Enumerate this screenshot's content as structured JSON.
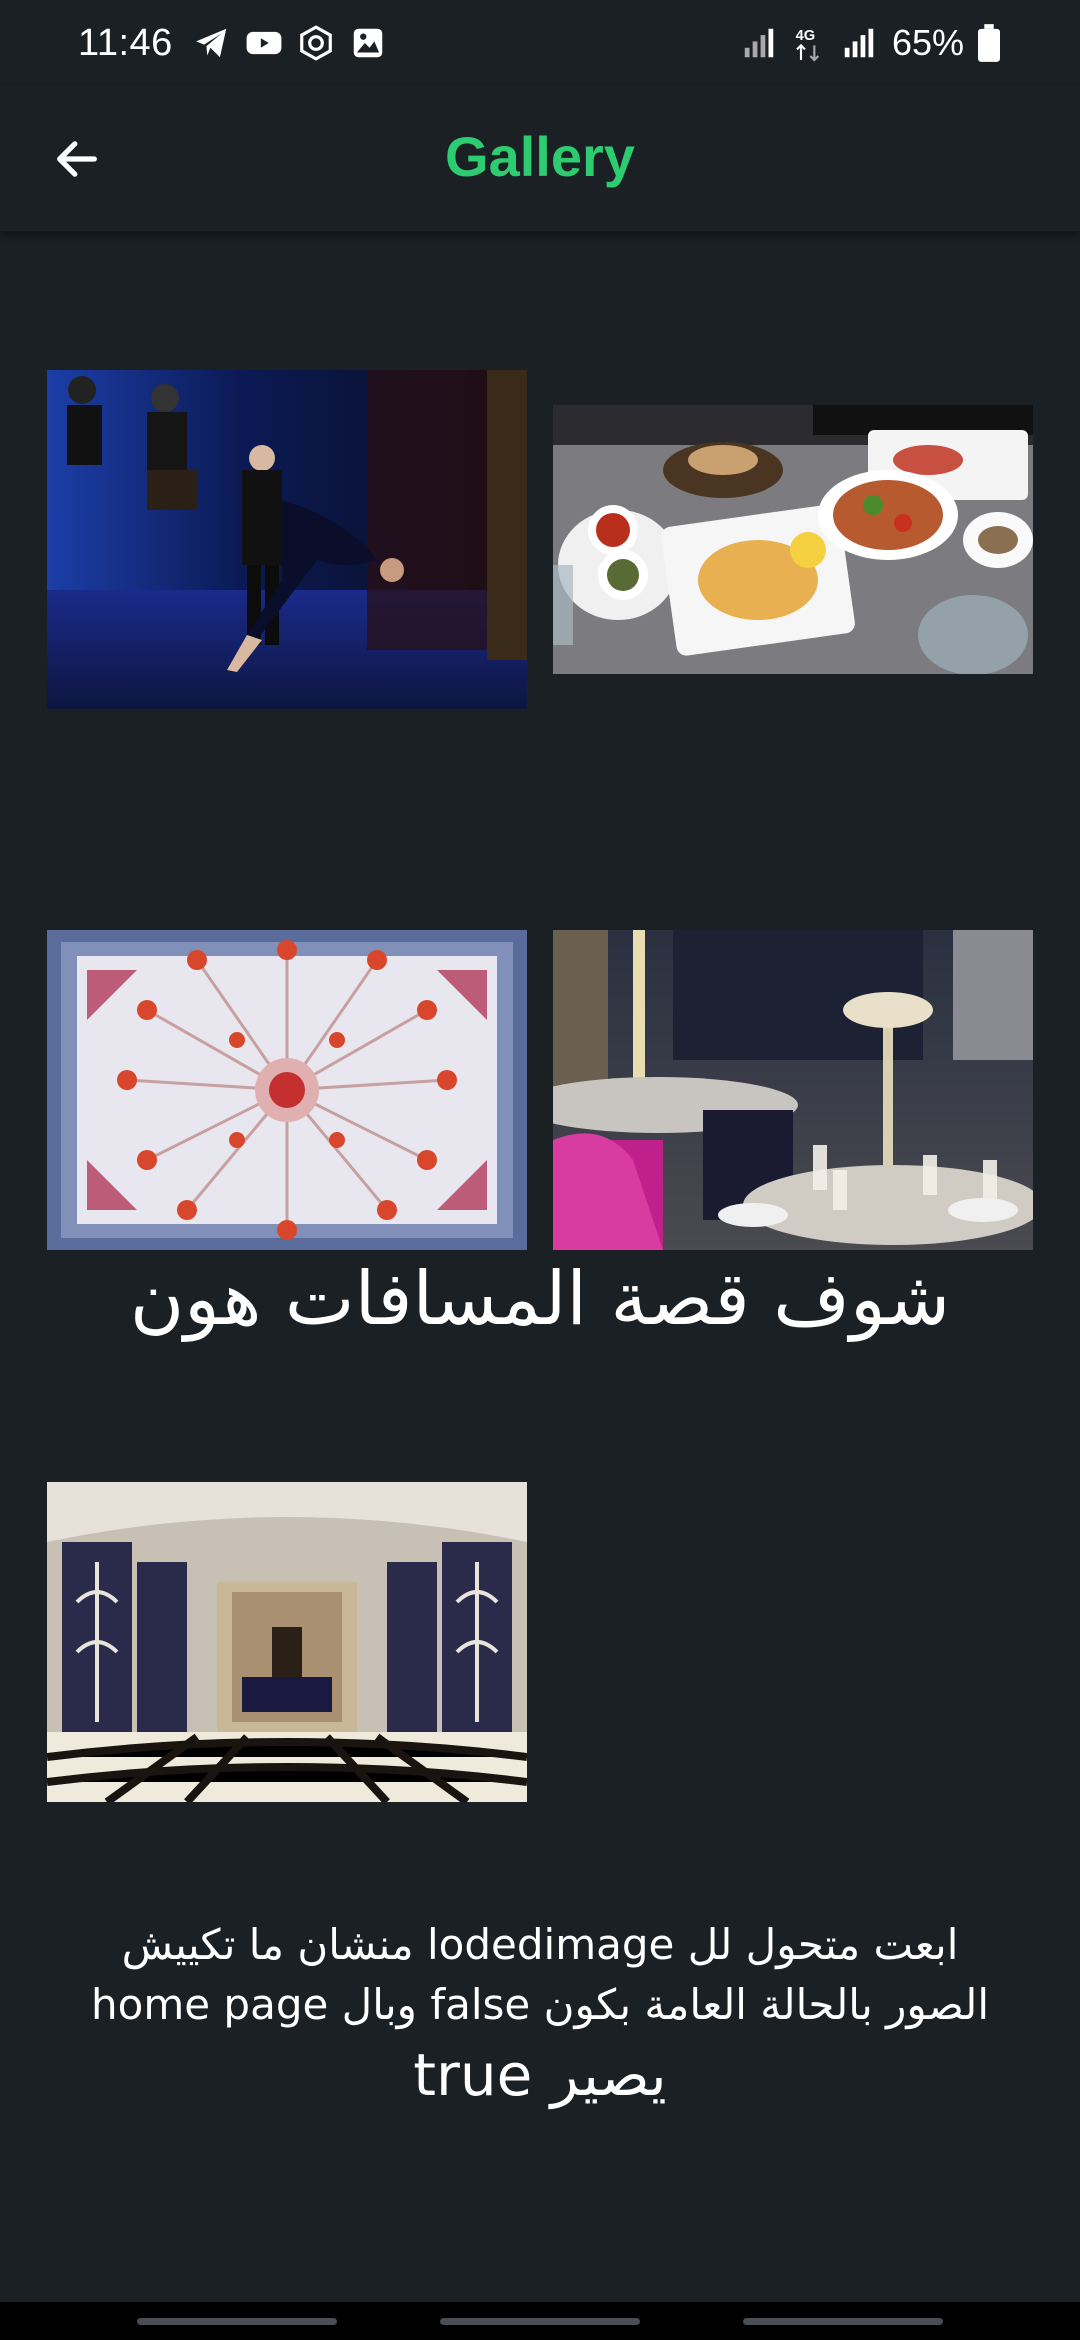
{
  "status_bar": {
    "time": "11:46",
    "network": "4G",
    "battery": "65%",
    "icons": [
      "telegram-icon",
      "youtube-icon",
      "hexagon-settings-icon",
      "image-icon",
      "signal-icon",
      "network-4g-icon",
      "signal-icon",
      "battery-icon"
    ]
  },
  "app_bar": {
    "title": "Gallery",
    "back_icon": "arrow-left-icon",
    "title_color": "#2ecc71"
  },
  "gallery": {
    "images": [
      {
        "name": "tango-dancers-photo",
        "description": "Tango dancers on stage"
      },
      {
        "name": "food-table-photo",
        "description": "Table with food dishes"
      },
      {
        "name": "chandelier-ceiling-photo",
        "description": "Chandelier on ornate ceiling"
      },
      {
        "name": "restaurant-dining-photo",
        "description": "Restaurant dining tables"
      },
      {
        "name": "lobby-hall-photo",
        "description": "Ornate lobby hall"
      }
    ],
    "overlay_caption": "شوف قصة المسافات هون"
  },
  "note": {
    "line1": "ابعت متحول لل lodedimage منشان ما تكييش",
    "line2": "الصور بالحالة العامة بكون false وبال home page",
    "line3": "يصير true"
  },
  "colors": {
    "background": "#1b2025",
    "accent": "#2ecc71"
  }
}
